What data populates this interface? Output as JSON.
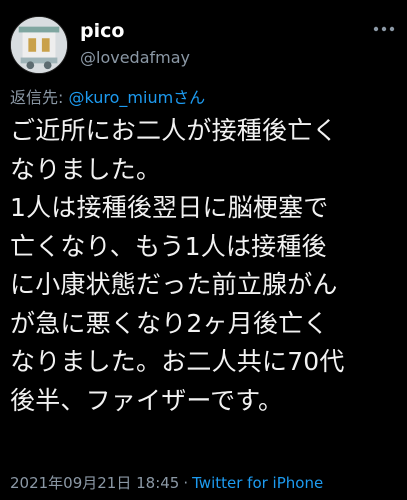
{
  "user": {
    "display_name": "pico",
    "handle": "@lovedafmay"
  },
  "reply": {
    "prefix": "返信先: ",
    "mention": "@kuro_miumさん"
  },
  "tweet": {
    "lines": [
      "ご近所にお二人が接種後亡く",
      "なりました。",
      "1人は接種後翌日に脳梗塞で",
      "亡くなり、もう1人は接種後",
      "に小康状態だった前立腺がん",
      "が急に悪くなり2ヶ月後亡く",
      "なりました。お二人共に70代",
      "後半、ファイザーです。"
    ]
  },
  "meta": {
    "timestamp": "2021年09月21日 18:45",
    "separator": "·",
    "source": "Twitter for iPhone"
  },
  "icons": {
    "more": "more-horizontal-icon"
  },
  "colors": {
    "background": "#000000",
    "text": "#f2f2f2",
    "secondary": "#8b98a5",
    "link": "#1d9bf0"
  }
}
